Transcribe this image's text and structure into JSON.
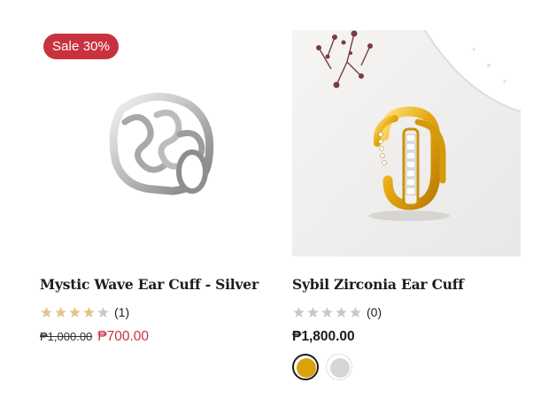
{
  "products": [
    {
      "title": "Mystic Wave Ear Cuff - Silver",
      "badge": "Sale 30%",
      "rating_count": "(1)",
      "stars": 4,
      "old_price": "₱1,000.00",
      "price": "₱700.00"
    },
    {
      "title": "Sybil Zirconia Ear Cuff",
      "rating_count": "(0)",
      "stars": 0,
      "price": "₱1,800.00",
      "swatches": [
        {
          "color": "#d9a20c",
          "selected": true
        },
        {
          "color": "#d6d6d6",
          "selected": false
        }
      ]
    }
  ],
  "colors": {
    "sale": "#c8323f",
    "star_filled": "#e6c48a",
    "star_empty": "#c9c9c9"
  }
}
